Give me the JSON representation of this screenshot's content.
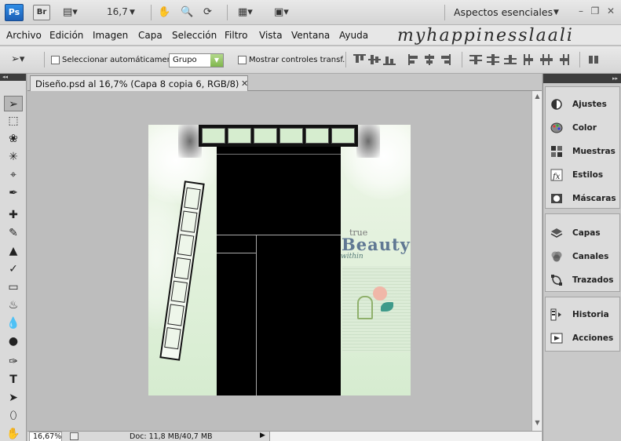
{
  "app": {
    "logo_ps": "Ps",
    "logo_br": "Br",
    "zoom_value": "16,7",
    "workspace": "Aspectos esenciales"
  },
  "menu": {
    "items": [
      "Archivo",
      "Edición",
      "Imagen",
      "Capa",
      "Selección",
      "Filtro",
      "Vista",
      "Ventana",
      "Ayuda"
    ],
    "watermark": "myhappinesslaali"
  },
  "options": {
    "auto_select_label": "Seleccionar automáticamente:",
    "auto_select_value": "Grupo",
    "show_transform_label": "Mostrar controles transf."
  },
  "document": {
    "tab_title": "Diseño.psd al 16,7% (Capa 8 copia 6, RGB/8)",
    "canvas_text_beauty": "Beauty",
    "canvas_text_true": "true",
    "canvas_text_script": "within"
  },
  "panels": {
    "group1": [
      {
        "label": "Ajustes",
        "icon": "adjustments-icon"
      },
      {
        "label": "Color",
        "icon": "color-palette-icon"
      },
      {
        "label": "Muestras",
        "icon": "swatches-icon"
      },
      {
        "label": "Estilos",
        "icon": "styles-fx-icon"
      },
      {
        "label": "Máscaras",
        "icon": "masks-icon"
      }
    ],
    "group2": [
      {
        "label": "Capas",
        "icon": "layers-icon"
      },
      {
        "label": "Canales",
        "icon": "channels-icon"
      },
      {
        "label": "Trazados",
        "icon": "paths-icon"
      }
    ],
    "group3": [
      {
        "label": "Historia",
        "icon": "history-icon"
      },
      {
        "label": "Acciones",
        "icon": "actions-play-icon"
      }
    ]
  },
  "status": {
    "zoom": "16,67%",
    "doc_info": "Doc: 11,8 MB/40,7 MB"
  },
  "colors": {
    "canvas_bg": "#d6ecd0",
    "beauty_text": "#607893",
    "ps_blue": "#2f8de6"
  }
}
